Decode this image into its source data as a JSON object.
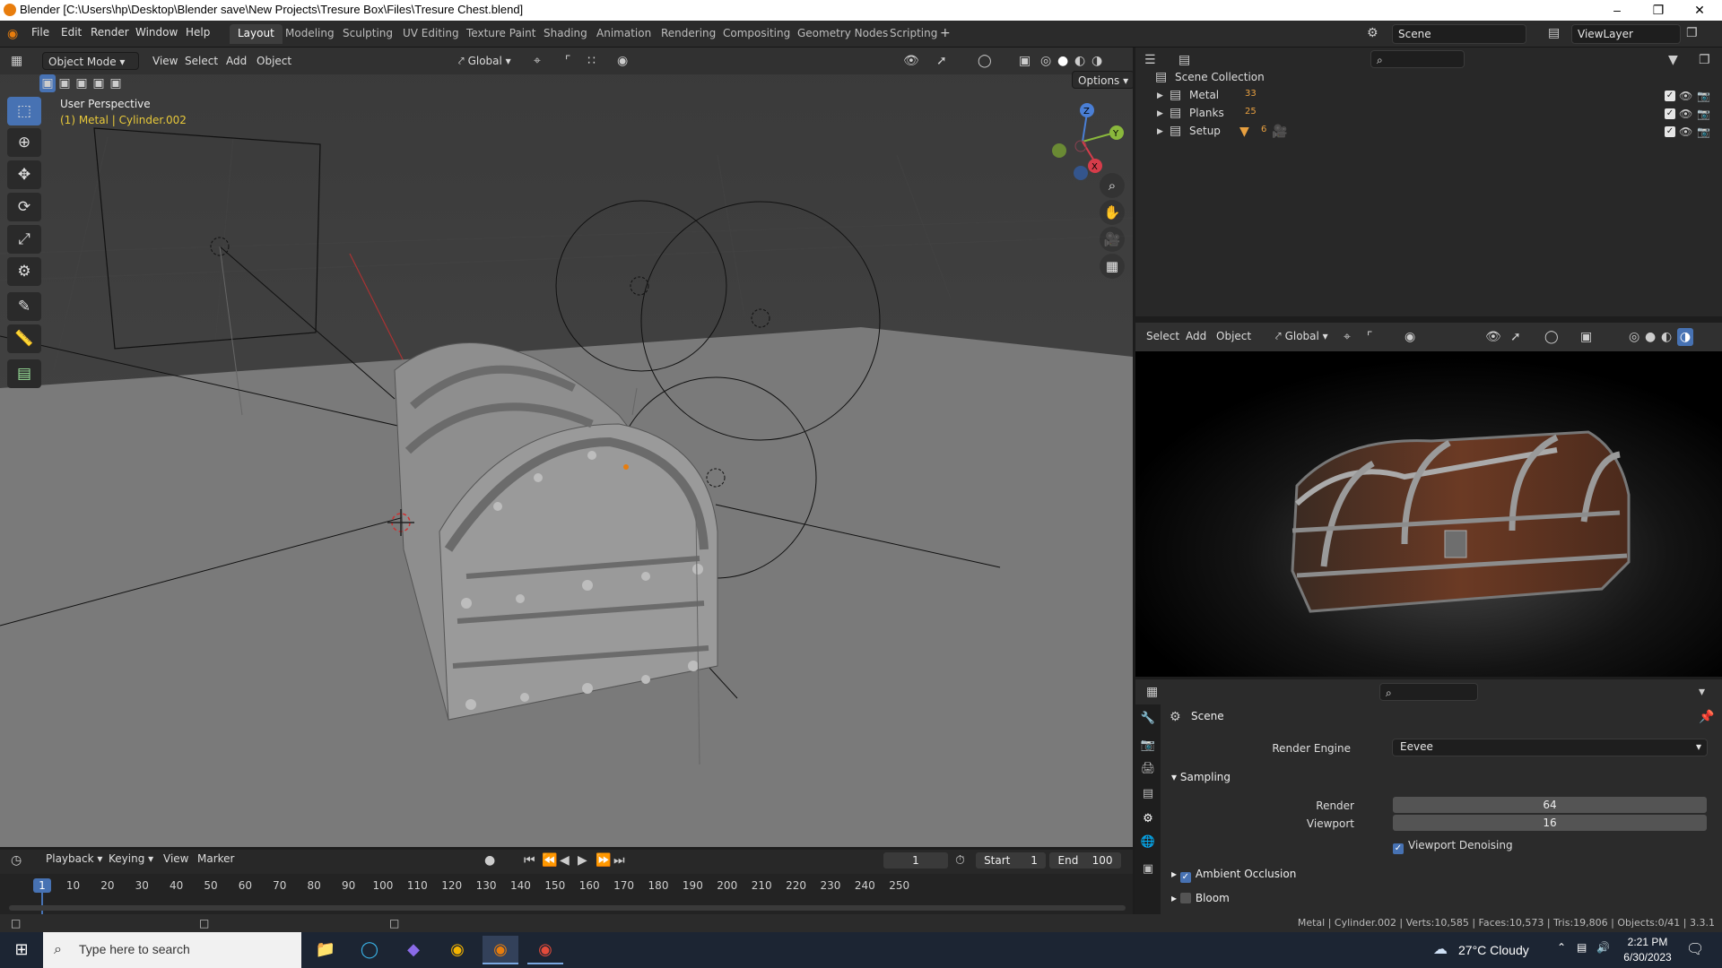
{
  "window": {
    "title": "Blender [C:\\Users\\hp\\Desktop\\Blender save\\New Projects\\Tresure Box\\Files\\Tresure Chest.blend]"
  },
  "menus": [
    "File",
    "Edit",
    "Render",
    "Window",
    "Help"
  ],
  "workspaces": [
    "Layout",
    "Modeling",
    "Sculpting",
    "UV Editing",
    "Texture Paint",
    "Shading",
    "Animation",
    "Rendering",
    "Compositing",
    "Geometry Nodes",
    "Scripting"
  ],
  "active_workspace": "Layout",
  "scene": {
    "name": "Scene",
    "view_layer": "ViewLayer"
  },
  "viewport": {
    "mode": "Object Mode",
    "menus": [
      "View",
      "Select",
      "Add",
      "Object"
    ],
    "orientation": "Global",
    "options_label": "Options",
    "perspective_label": "User Perspective",
    "active_object_label": "(1) Metal | Cylinder.002",
    "gizmo_axes": [
      "Z",
      "Y",
      "X"
    ]
  },
  "outliner": {
    "root": "Scene Collection",
    "collections": [
      {
        "name": "Metal",
        "badge": "33"
      },
      {
        "name": "Planks",
        "badge": "25"
      },
      {
        "name": "Setup",
        "badge": "6"
      }
    ]
  },
  "render_preview": {
    "menus": [
      "Select",
      "Add",
      "Object"
    ],
    "orientation": "Global"
  },
  "properties": {
    "context": "Scene",
    "render_engine_label": "Render Engine",
    "render_engine": "Eevee",
    "sampling_label": "Sampling",
    "render_label": "Render",
    "render_samples": "64",
    "viewport_label": "Viewport",
    "viewport_samples": "16",
    "viewport_denoising_label": "Viewport Denoising",
    "viewport_denoising": true,
    "ambient_occlusion_label": "Ambient Occlusion",
    "ambient_occlusion": true,
    "bloom_label": "Bloom",
    "bloom": false
  },
  "timeline": {
    "menus": [
      "Playback",
      "Keying",
      "View",
      "Marker"
    ],
    "current_frame": "1",
    "start_label": "Start",
    "start": "1",
    "end_label": "End",
    "end": "100",
    "ticks": [
      "1",
      "10",
      "20",
      "30",
      "40",
      "50",
      "60",
      "70",
      "80",
      "90",
      "100",
      "110",
      "120",
      "130",
      "140",
      "150",
      "160",
      "170",
      "180",
      "190",
      "200",
      "210",
      "220",
      "230",
      "240",
      "250"
    ]
  },
  "statusbar": {
    "text": "Metal | Cylinder.002 | Verts:10,585 | Faces:10,573 | Tris:19,806 | Objects:0/41 | 3.3.1"
  },
  "taskbar": {
    "search_placeholder": "Type here to search",
    "weather": "27°C  Cloudy",
    "time": "2:21 PM",
    "date": "6/30/2023"
  },
  "colors": {
    "accent": "#4772b3",
    "active_label": "#e8c93a",
    "blender_orange": "#e87d0d"
  }
}
